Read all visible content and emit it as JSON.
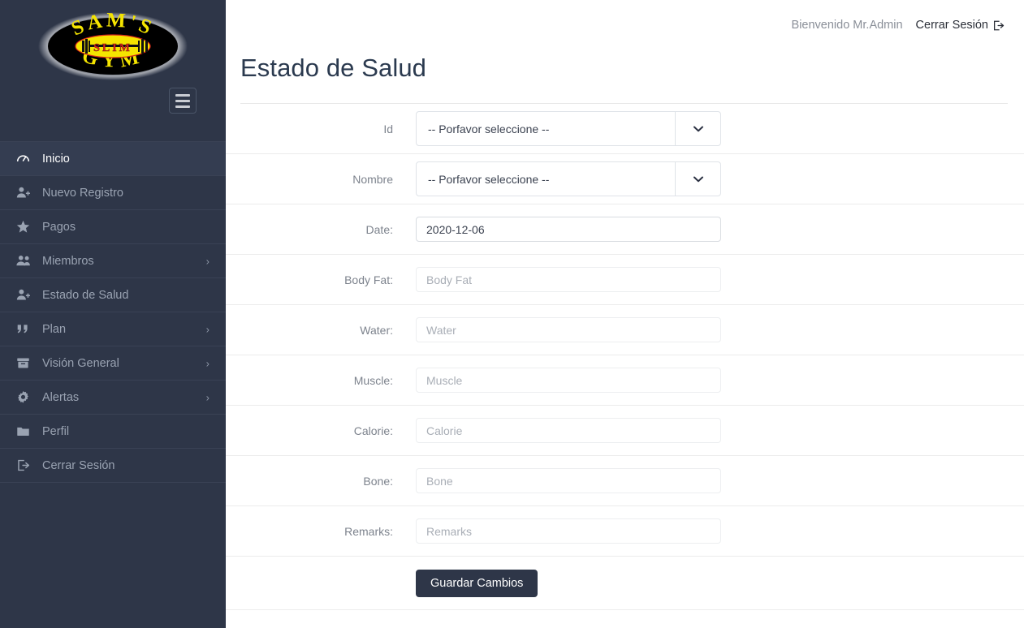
{
  "colors": {
    "sidebar_bg": "#2e3648",
    "sidebar_active_bg": "#343d51",
    "sidebar_text": "#9aa3b2",
    "title_text": "#2b3a4f",
    "button_bg": "#2e3648",
    "logo_yellow": "#f5e500",
    "logo_red": "#d9251d",
    "logo_black": "#000000"
  },
  "sidebar": {
    "logo": {
      "icon": "gym-logo",
      "top_text": "S A M ' S",
      "bottom_text": "G Y M",
      "center_text": "S L I M"
    },
    "toggle": {
      "icon": "hamburger-icon",
      "label": "Menu"
    },
    "items": [
      {
        "label": "Inicio",
        "icon": "dashboard-icon",
        "active": true,
        "caret": false
      },
      {
        "label": "Nuevo Registro",
        "icon": "user-plus-icon",
        "active": false,
        "caret": false
      },
      {
        "label": "Pagos",
        "icon": "star-icon",
        "active": false,
        "caret": false
      },
      {
        "label": "Miembros",
        "icon": "users-icon",
        "active": false,
        "caret": true
      },
      {
        "label": "Estado de Salud",
        "icon": "user-plus-icon",
        "active": false,
        "caret": false
      },
      {
        "label": "Plan",
        "icon": "quote-icon",
        "active": false,
        "caret": true
      },
      {
        "label": "Visión General",
        "icon": "archive-icon",
        "active": false,
        "caret": true
      },
      {
        "label": "Alertas",
        "icon": "gear-icon",
        "active": false,
        "caret": true
      },
      {
        "label": "Perfil",
        "icon": "folder-icon",
        "active": false,
        "caret": false
      },
      {
        "label": "Cerrar Sesión",
        "icon": "sign-out-icon",
        "active": false,
        "caret": false
      }
    ],
    "caret_glyph": "›"
  },
  "topbar": {
    "welcome": "Bienvenido Mr.Admin",
    "logout_label": "Cerrar Sesión",
    "logout_icon": "sign-out-icon"
  },
  "page": {
    "title": "Estado de Salud"
  },
  "form": {
    "rows": [
      {
        "label": "Id",
        "type": "select",
        "value": "-- Porfavor seleccione --"
      },
      {
        "label": "Nombre",
        "type": "select",
        "value": "-- Porfavor seleccione --"
      },
      {
        "label": "Date:",
        "type": "text",
        "value": "2020-12-06",
        "placeholder": ""
      },
      {
        "label": "Body Fat:",
        "type": "text",
        "value": "",
        "placeholder": "Body Fat"
      },
      {
        "label": "Water:",
        "type": "text",
        "value": "",
        "placeholder": "Water"
      },
      {
        "label": "Muscle:",
        "type": "text",
        "value": "",
        "placeholder": "Muscle"
      },
      {
        "label": "Calorie:",
        "type": "text",
        "value": "",
        "placeholder": "Calorie"
      },
      {
        "label": "Bone:",
        "type": "text",
        "value": "",
        "placeholder": "Bone"
      },
      {
        "label": "Remarks:",
        "type": "text",
        "value": "",
        "placeholder": "Remarks"
      }
    ],
    "submit_label": "Guardar Cambios"
  }
}
